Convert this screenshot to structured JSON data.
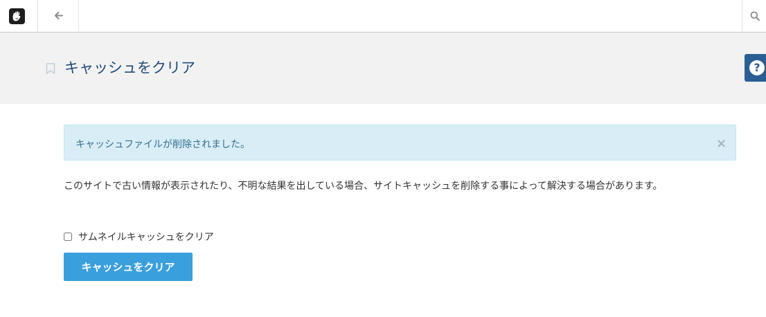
{
  "topbar": {
    "logo_icon": "concrete5-hand-logo-icon",
    "back_icon": "arrow-left-icon",
    "search_icon": "search-icon"
  },
  "header": {
    "title": "キャッシュをクリア",
    "bookmark_icon": "bookmark-icon",
    "help_icon": "question-circle-icon"
  },
  "alert": {
    "message": "キャッシュファイルが削除されました。",
    "close_label": "×"
  },
  "description": "このサイトで古い情報が表示されたり、不明な結果を出している場合、サイトキャッシュを削除する事によって解決する場合があります。",
  "form": {
    "checkbox_label": "サムネイルキャッシュをクリア",
    "checkbox_checked": false,
    "submit_label": "キャッシュをクリア"
  },
  "colors": {
    "title": "#1f4b7a",
    "alert_bg": "#d9edf7",
    "alert_text": "#31708f",
    "button": "#3a9fdd",
    "help_tab": "#2a5f95"
  }
}
